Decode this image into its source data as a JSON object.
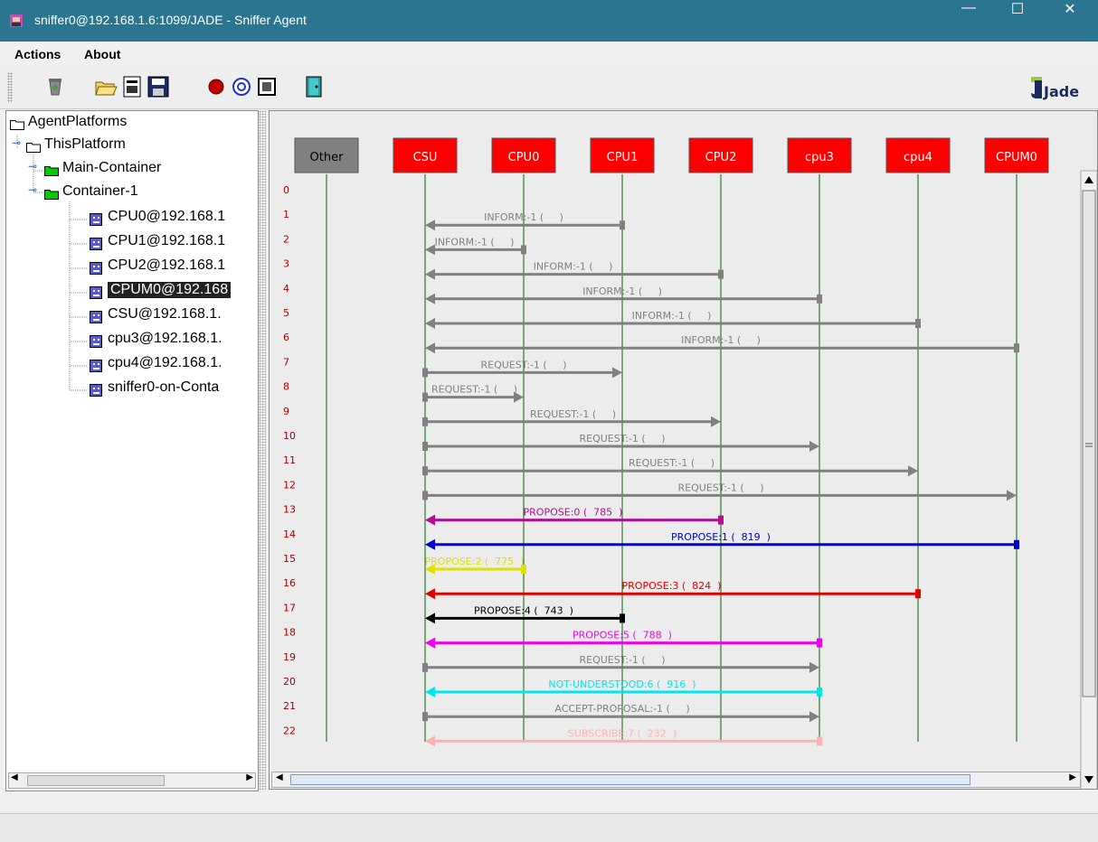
{
  "window": {
    "title": "sniffer0@192.168.1.6:1099/JADE - Sniffer Agent",
    "minimize": "—",
    "maximize": "☐",
    "close": "✕"
  },
  "menu": {
    "actions": "Actions",
    "about": "About"
  },
  "toolbar": {
    "buttons": [
      "trash-icon",
      "open-folder-icon",
      "open-file-icon",
      "save-icon",
      "record-icon",
      "at-icon",
      "window-icon",
      "exit-door-icon"
    ],
    "logo": "Jade"
  },
  "tree": {
    "root": "AgentPlatforms",
    "platform": "ThisPlatform",
    "main_container": "Main-Container",
    "container1": "Container-1",
    "agents": [
      "CPU0@192.168.1",
      "CPU1@192.168.1",
      "CPU2@192.168.1",
      "CPUM0@192.168",
      "CSU@192.168.1.",
      "cpu3@192.168.1.",
      "cpu4@192.168.1.",
      "sniffer0-on-Conta"
    ],
    "selected_index": 3
  },
  "sniffer": {
    "agents": [
      {
        "name": "Other",
        "color": "#808080"
      },
      {
        "name": "CSU",
        "color": "#ff0000"
      },
      {
        "name": "CPU0",
        "color": "#ff0000"
      },
      {
        "name": "CPU1",
        "color": "#ff0000"
      },
      {
        "name": "CPU2",
        "color": "#ff0000"
      },
      {
        "name": "cpu3",
        "color": "#ff0000"
      },
      {
        "name": "cpu4",
        "color": "#ff0000"
      },
      {
        "name": "CPUM0",
        "color": "#ff0000"
      }
    ],
    "messages": [
      {
        "row": 0,
        "label": "",
        "from": "",
        "to": "",
        "color": ""
      },
      {
        "row": 1,
        "label": "INFORM:-1 (     )",
        "from": "CPU1",
        "to": "CSU",
        "color": "#808080"
      },
      {
        "row": 2,
        "label": "INFORM:-1 (     )",
        "from": "CPU0",
        "to": "CSU",
        "color": "#808080"
      },
      {
        "row": 3,
        "label": "INFORM:-1 (     )",
        "from": "CPU2",
        "to": "CSU",
        "color": "#808080"
      },
      {
        "row": 4,
        "label": "INFORM:-1 (     )",
        "from": "cpu3",
        "to": "CSU",
        "color": "#808080"
      },
      {
        "row": 5,
        "label": "INFORM:-1 (     )",
        "from": "cpu4",
        "to": "CSU",
        "color": "#808080"
      },
      {
        "row": 6,
        "label": "INFORM:-1 (     )",
        "from": "CPUM0",
        "to": "CSU",
        "color": "#808080"
      },
      {
        "row": 7,
        "label": "REQUEST:-1 (     )",
        "from": "CSU",
        "to": "CPU1",
        "color": "#808080"
      },
      {
        "row": 8,
        "label": "REQUEST:-1 (     )",
        "from": "CSU",
        "to": "CPU0",
        "color": "#808080"
      },
      {
        "row": 9,
        "label": "REQUEST:-1 (     )",
        "from": "CSU",
        "to": "CPU2",
        "color": "#808080"
      },
      {
        "row": 10,
        "label": "REQUEST:-1 (     )",
        "from": "CSU",
        "to": "cpu3",
        "color": "#808080"
      },
      {
        "row": 11,
        "label": "REQUEST:-1 (     )",
        "from": "CSU",
        "to": "cpu4",
        "color": "#808080"
      },
      {
        "row": 12,
        "label": "REQUEST:-1 (     )",
        "from": "CSU",
        "to": "CPUM0",
        "color": "#808080"
      },
      {
        "row": 13,
        "label": "PROPOSE:0 (  785  )",
        "from": "CPU2",
        "to": "CSU",
        "color": "#b0108f"
      },
      {
        "row": 14,
        "label": "PROPOSE:1 (  819  )",
        "from": "CPUM0",
        "to": "CSU",
        "color": "#0000cc"
      },
      {
        "row": 15,
        "label": "PROPOSE:2 (  775  )",
        "from": "CPU0",
        "to": "CSU",
        "color": "#e0e000"
      },
      {
        "row": 16,
        "label": "PROPOSE:3 (  824  )",
        "from": "cpu4",
        "to": "CSU",
        "color": "#dd0000"
      },
      {
        "row": 17,
        "label": "PROPOSE:4 (  743  )",
        "from": "CPU1",
        "to": "CSU",
        "color": "#000000"
      },
      {
        "row": 18,
        "label": "PROPOSE:5 (  788  )",
        "from": "cpu3",
        "to": "CSU",
        "color": "#ee00ee"
      },
      {
        "row": 19,
        "label": "REQUEST:-1 (     )",
        "from": "CSU",
        "to": "cpu3",
        "color": "#808080"
      },
      {
        "row": 20,
        "label": "NOT-UNDERSTOOD:6 (  916  )",
        "from": "cpu3",
        "to": "CSU",
        "color": "#00e5ee"
      },
      {
        "row": 21,
        "label": "ACCEPT-PROPOSAL:-1 (     )",
        "from": "CSU",
        "to": "cpu3",
        "color": "#808080"
      },
      {
        "row": 22,
        "label": "SUBSCRIBE:7 (  232  )",
        "from": "cpu3",
        "to": "CSU",
        "color": "#ffb0b0"
      }
    ],
    "row_number_color": "#aa0000",
    "lifeline_color": "#006600"
  }
}
